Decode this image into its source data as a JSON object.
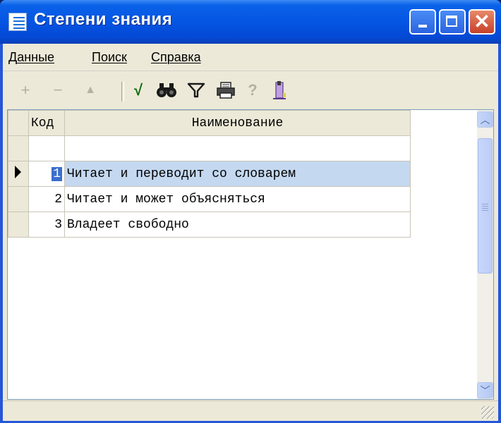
{
  "window": {
    "title": "Степени знания"
  },
  "menu": [
    {
      "hotkey": "Д",
      "rest": "анные"
    },
    {
      "hotkey": "П",
      "rest": "оиск"
    },
    {
      "hotkey": "С",
      "rest": "правка"
    }
  ],
  "toolbar": {
    "add": "+",
    "remove": "−",
    "up": "▲",
    "post": "√",
    "find": "🔍",
    "filter": "▽",
    "print": "🖶",
    "help": "?",
    "exit": "🚪"
  },
  "grid": {
    "headers": {
      "code": "Код",
      "name": "Наименование"
    },
    "rows": [
      {
        "code": "",
        "name": ""
      },
      {
        "code": "1",
        "name": "Читает и переводит со словарем"
      },
      {
        "code": "2",
        "name": "Читает и может объясняться"
      },
      {
        "code": "3",
        "name": "Владеет свободно"
      }
    ]
  },
  "colors": {
    "titlebar": "#0555e3",
    "window_bg": "#ece9d8",
    "selection": "#3a6ecc",
    "selected_row": "#c4d8f0"
  }
}
